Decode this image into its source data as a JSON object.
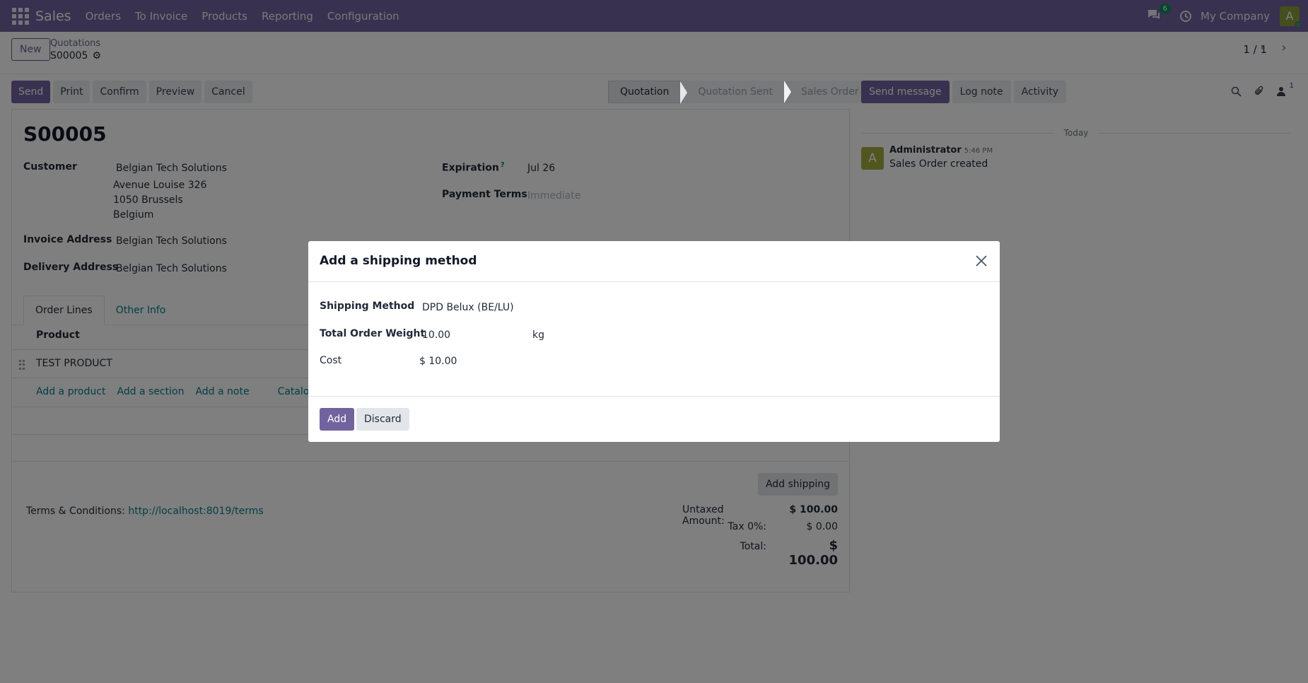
{
  "navbar": {
    "app_name": "Sales",
    "menu": [
      "Orders",
      "To Invoice",
      "Products",
      "Reporting",
      "Configuration"
    ],
    "messages_count": "6",
    "company": "My Company",
    "user_initial": "A"
  },
  "control_panel": {
    "new_label": "New",
    "breadcrumb_parent": "Quotations",
    "breadcrumb_current": "S00005",
    "pager": "1 / 1"
  },
  "actions": [
    "Send",
    "Print",
    "Confirm",
    "Preview",
    "Cancel"
  ],
  "statusbar": [
    "Quotation",
    "Quotation Sent",
    "Sales Order"
  ],
  "form": {
    "name": "S00005",
    "customer_label": "Customer",
    "customer_name": "Belgian Tech Solutions",
    "customer_street": "Avenue Louise 326",
    "customer_city": "1050 Brussels",
    "customer_country": "Belgium",
    "invoice_address_label": "Invoice Address",
    "invoice_address": "Belgian Tech Solutions",
    "delivery_address_label": "Delivery Address",
    "delivery_address": "Belgian Tech Solutions",
    "expiration_label": "Expiration",
    "expiration_help": "?",
    "expiration": "Jul 26",
    "payment_terms_label": "Payment Terms",
    "payment_terms_placeholder": "Immediate",
    "tabs": [
      "Order Lines",
      "Other Info"
    ],
    "product_header": "Product",
    "line_product": "TEST PRODUCT",
    "add_links": [
      "Add a product",
      "Add a section",
      "Add a note"
    ],
    "catalog_label": "Catalog",
    "add_shipping_label": "Add shipping",
    "terms_label": "Terms & Conditions:",
    "terms_link": "http://localhost:8019/terms",
    "untaxed_label": "Untaxed Amount:",
    "untaxed_value": "$ 100.00",
    "tax_label": "Tax 0%:",
    "tax_value": "$ 0.00",
    "total_label": "Total:",
    "total_value": "$ 100.00"
  },
  "chatter": {
    "send_message": "Send message",
    "log_note": "Log note",
    "activity": "Activity",
    "followers_count": "1",
    "today": "Today",
    "author_initial": "A",
    "author": "Administrator",
    "time": "5:46 PM",
    "body": "Sales Order created"
  },
  "dialog": {
    "title": "Add a shipping method",
    "shipping_method_label": "Shipping Method",
    "shipping_method": "DPD Belux (BE/LU)",
    "weight_label": "Total Order Weight",
    "weight": "10.00",
    "weight_unit": "kg",
    "cost_label": "Cost",
    "cost": "$ 10.00",
    "add_label": "Add",
    "discard_label": "Discard"
  },
  "colors": {
    "brand": "#71639e",
    "link": "#017e84"
  }
}
